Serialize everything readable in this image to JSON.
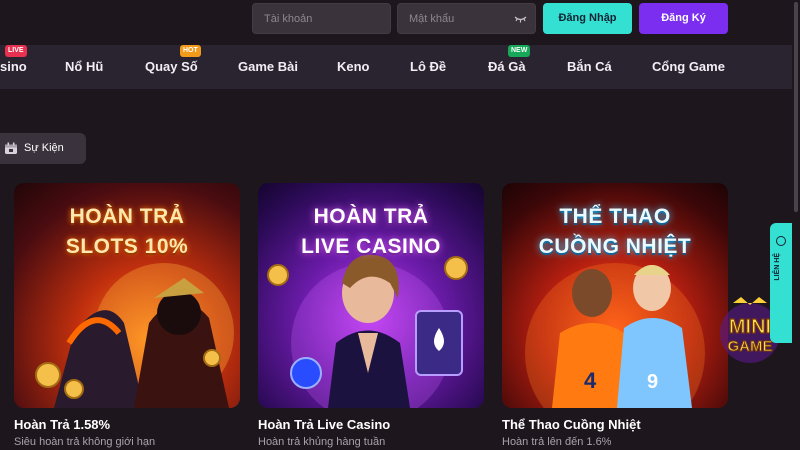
{
  "header": {
    "username_placeholder": "Tài khoản",
    "password_placeholder": "Mật khẩu",
    "login_label": "Đăng Nhập",
    "register_label": "Đăng Ký"
  },
  "nav": {
    "items": [
      {
        "label": "sino"
      },
      {
        "label": "Nổ Hũ"
      },
      {
        "label": "Quay Số"
      },
      {
        "label": "Game Bài"
      },
      {
        "label": "Keno"
      },
      {
        "label": "Lô Đề"
      },
      {
        "label": "Đá Gà"
      },
      {
        "label": "Bắn Cá"
      },
      {
        "label": "Cổng Game"
      }
    ],
    "badges": {
      "live": "LIVE",
      "hot": "HOT",
      "new": "NEW"
    }
  },
  "events": {
    "label": "Sự Kiện"
  },
  "cards": [
    {
      "headline_1": "HOÀN TRẢ",
      "headline_2": "SLOTS 10%",
      "title": "Hoàn Trả 1.58%",
      "subtitle": "Siêu hoàn trả không giới hạn"
    },
    {
      "headline_1": "HOÀN TRẢ",
      "headline_2": "LIVE CASINO",
      "title": "Hoàn Trả Live Casino",
      "subtitle": "Hoàn trả khủng hàng tuần"
    },
    {
      "headline_1": "THỂ THAO",
      "headline_2": "CUỒNG NHIỆT",
      "title": "Thể Thao Cuồng Nhiệt",
      "subtitle": "Hoàn trả lên đến 1.6%"
    }
  ],
  "contact": {
    "label": "LIÊN HỆ"
  },
  "minigame": {
    "line1": "MINI",
    "line2": "GAME"
  },
  "colors": {
    "background": "#1d161d",
    "nav_bg": "#2a2330",
    "accent_cyan": "#33e0d2",
    "accent_purple": "#7b2df0"
  }
}
